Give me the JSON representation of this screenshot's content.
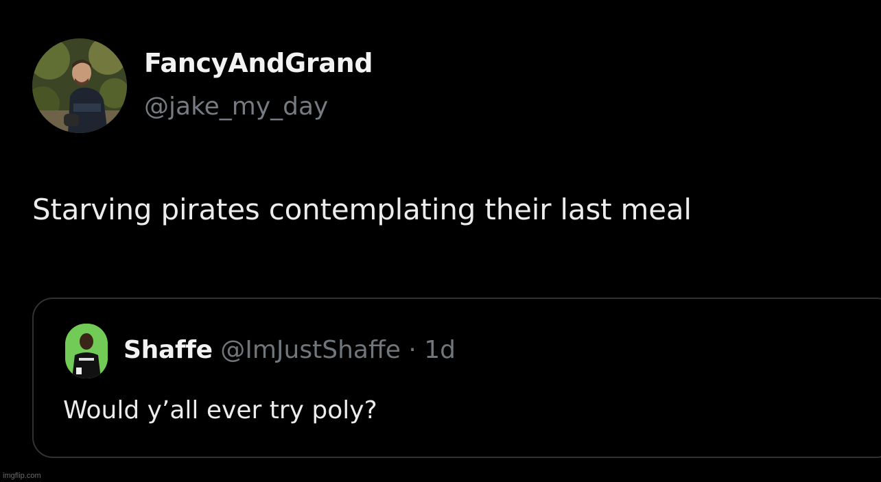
{
  "tweet": {
    "author": {
      "display_name": "FancyAndGrand",
      "handle": "@jake_my_day",
      "avatar": "user-avatar-photo"
    },
    "text": "Starving pirates contemplating their last meal"
  },
  "quoted_tweet": {
    "author": {
      "display_name": "Shaffe",
      "handle": "@ImJustShaffe",
      "avatar": "user-avatar-photo"
    },
    "separator": "·",
    "time": "1d",
    "text": "Would y’all ever try poly?"
  },
  "watermark": "imgflip.com",
  "colors": {
    "background": "#000000",
    "primary_text": "#e7e9ea",
    "secondary_text": "#71767b",
    "card_border": "#2f3336",
    "quote_avatar_bg": "#5bc23a"
  }
}
